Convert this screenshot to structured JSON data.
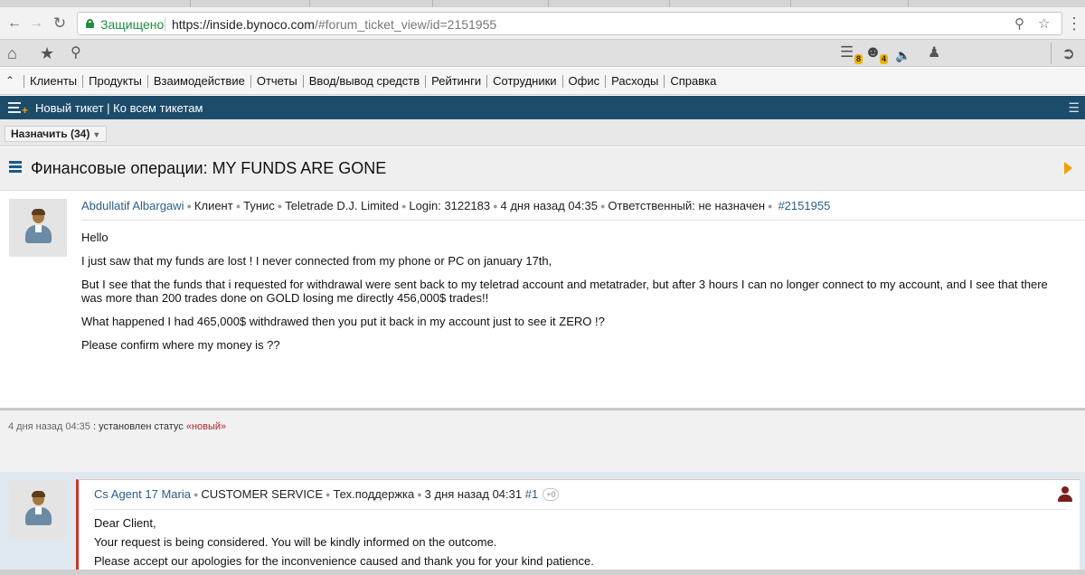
{
  "browser": {
    "secure_label": "Защищено",
    "url_host": "https://inside.bynoco.com",
    "url_rest": "/#forum_ticket_view/id=2151955",
    "back_icon": "arrow-left-icon",
    "forward_icon": "arrow-right-icon",
    "reload_icon": "reload-icon",
    "zoom_icon": "zoom-icon",
    "bookmark_icon": "star-icon",
    "menu_icon": "kebab-menu-icon"
  },
  "appbar": {
    "notifications_count": "8",
    "messages_count": "4"
  },
  "menu": {
    "items": [
      "Клиенты",
      "Продукты",
      "Взаимодействие",
      "Отчеты",
      "Ввод/вывод средств",
      "Рейтинги",
      "Сотрудники",
      "Офис",
      "Расходы",
      "Справка"
    ]
  },
  "ticketbar": {
    "new_ticket": "Новый тикет",
    "separator": " | ",
    "all_tickets": "Ко всем тикетам"
  },
  "assign": {
    "label": "Назначить (34)"
  },
  "page": {
    "title": "Финансовые операции: MY FUNDS ARE GONE"
  },
  "post": {
    "author": "Abdullatif Albargawi",
    "role": "Клиент",
    "country": "Тунис",
    "company": "Teletrade D.J. Limited",
    "login": "Login: 3122183",
    "time": "4 дня назад 04:35",
    "responsible": "Ответственный: не назначен",
    "ticket_id": "#2151955",
    "body": [
      "Hello",
      "I just saw that my funds are lost ! I never connected from my phone or PC on january 17th,",
      "But I see that the funds that i requested for withdrawal were sent back to my teletrad account and metatrader, but after 3 hours I can no longer connect to my account, and I see that there was more than 200 trades done on GOLD losing me directly 456,000$ trades!!",
      "What happened I had 465,000$ withdrawed then you put it back in my account just to see it ZERO !?",
      "Please confirm where my money is ??"
    ]
  },
  "history": {
    "time": "4 дня назад 04:35",
    "text": " : установлен статус ",
    "status": "«новый»"
  },
  "reply": {
    "author": "Cs Agent 17 Maria",
    "department": "CUSTOMER SERVICE",
    "category": "Тех.поддержка",
    "time": "3 дня назад 04:31",
    "number": "#1",
    "plus": "+0",
    "body": [
      "Dear Client,",
      "Your request is being considered. You will be kindly informed on the outcome.",
      "Please accept our apologies for the inconvenience caused and thank you for your kind patience."
    ]
  }
}
